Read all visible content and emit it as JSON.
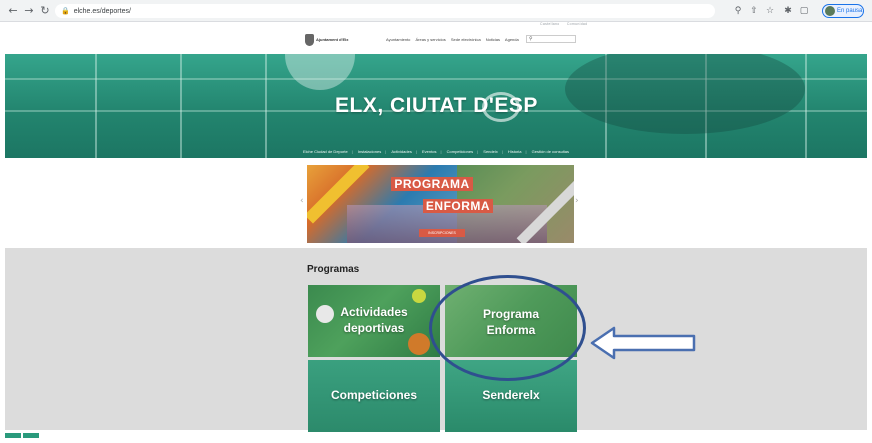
{
  "browser": {
    "url": "elche.es/deportes/",
    "profile_label": "En pausa",
    "icons": [
      "back-arrow-icon",
      "forward-arrow-icon",
      "reload-icon",
      "lock-icon",
      "zoom-icon",
      "share-icon",
      "star-icon",
      "extension-icon",
      "sidebar-icon"
    ]
  },
  "login_bar": {
    "items": [
      "Castellano",
      "Comunidad"
    ]
  },
  "header": {
    "logo_text": "Ajuntament d'Elx",
    "nav": [
      "Ayuntamiento",
      "Áreas y servicios",
      "Sede electrónica",
      "Noticias",
      "Agenda"
    ]
  },
  "hero": {
    "title": "ELX, CIUTAT D'ESP",
    "nav": [
      "Elche Ciudad de Deporte",
      "Instalaciones",
      "Actividades",
      "Eventos",
      "Competiciones",
      "Sendelx",
      "Historia",
      "Gestión de consultas"
    ]
  },
  "banner": {
    "line1": "PROGRAMA",
    "line2": "ENFORMA",
    "cta": "INSCRIPCIONES"
  },
  "programs": {
    "title": "Programas",
    "tiles": [
      {
        "line1": "Actividades",
        "line2": "deportivas"
      },
      {
        "line1": "Programa",
        "line2": "Enforma"
      },
      {
        "line1": "Competiciones",
        "line2": ""
      },
      {
        "line1": "Senderelx",
        "line2": ""
      }
    ]
  },
  "colors": {
    "accent": "#2a9580",
    "annotation": "#2f4f8f",
    "banner_red": "#d85a45"
  }
}
